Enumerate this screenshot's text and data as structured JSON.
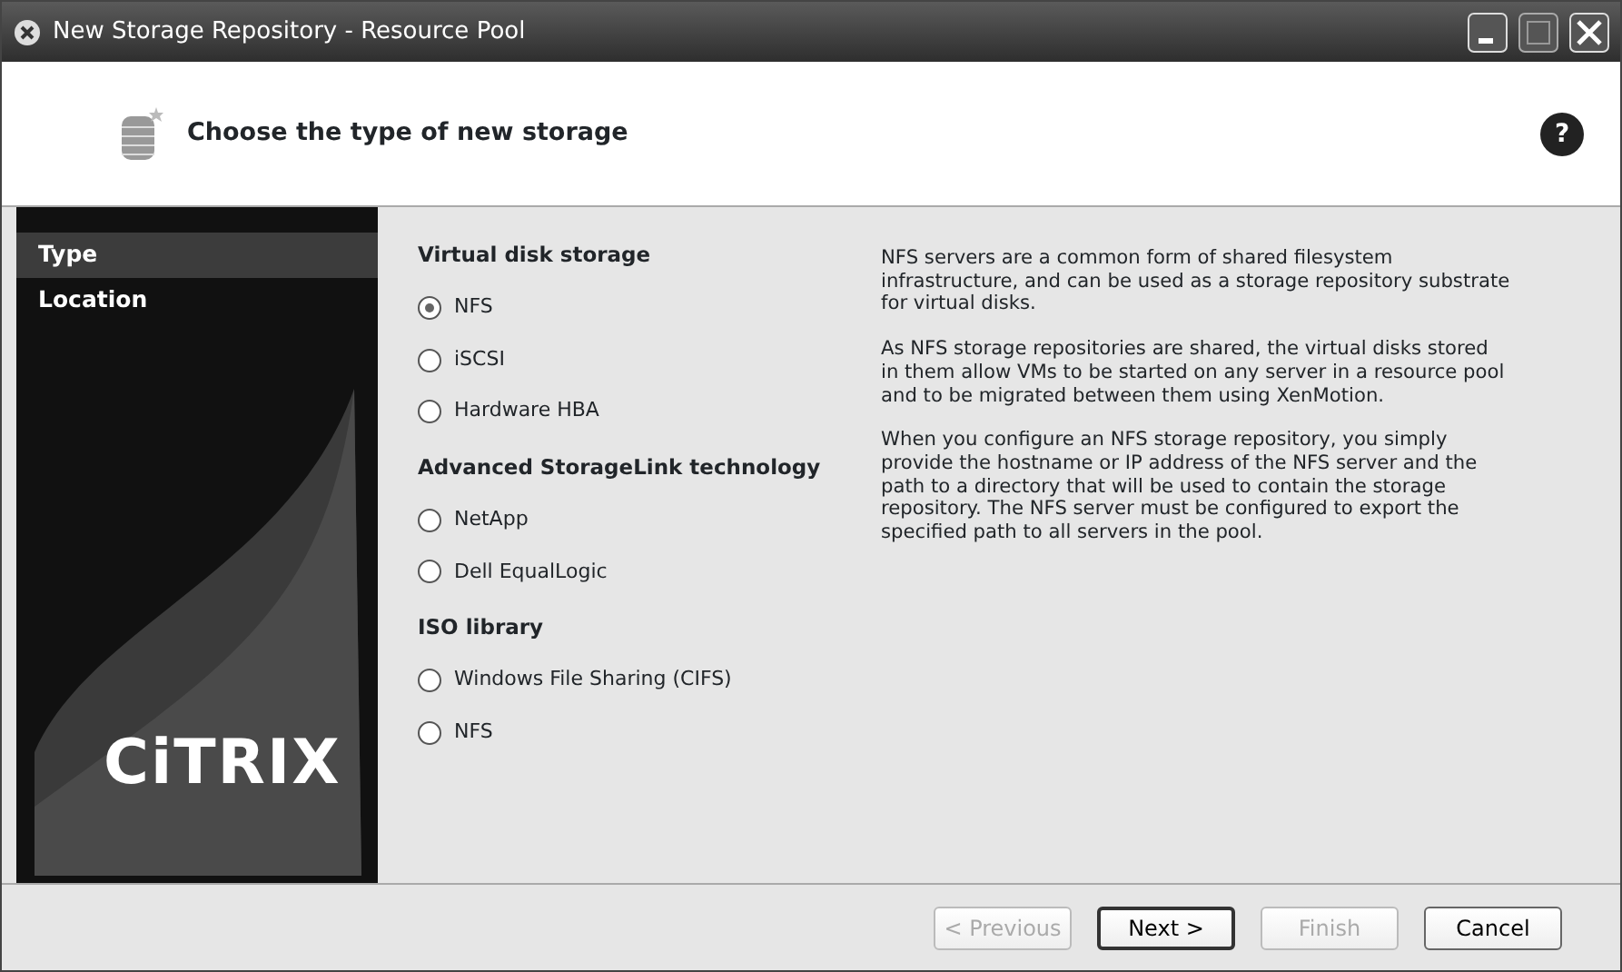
{
  "window": {
    "title": "New Storage Repository - Resource Pool"
  },
  "header": {
    "title": "Choose the type of new storage",
    "help": "?"
  },
  "sidebar": {
    "items": [
      {
        "label": "Type",
        "selected": true
      },
      {
        "label": "Location",
        "selected": false
      }
    ],
    "logo": "CiTRIX"
  },
  "groups": [
    {
      "heading": "Virtual disk storage",
      "options": [
        {
          "label": "NFS",
          "selected": true
        },
        {
          "label": "iSCSI",
          "selected": false
        },
        {
          "label": "Hardware HBA",
          "selected": false
        }
      ]
    },
    {
      "heading": "Advanced StorageLink technology",
      "options": [
        {
          "label": "NetApp",
          "selected": false
        },
        {
          "label": "Dell EqualLogic",
          "selected": false
        }
      ]
    },
    {
      "heading": "ISO library",
      "options": [
        {
          "label": "Windows File Sharing (CIFS)",
          "selected": false
        },
        {
          "label": "NFS",
          "selected": false
        }
      ]
    }
  ],
  "description": [
    "NFS servers are a common form of shared filesystem infrastructure, and can be used as a storage repository substrate for virtual disks.",
    "As NFS storage repositories are shared, the virtual disks stored in them allow VMs to be started on any server in a resource pool and to be migrated between them using XenMotion.",
    "When you configure an NFS storage repository, you simply provide the hostname or IP address of the NFS server and the path to a directory that will be used to contain the storage repository. The NFS server must be configured to export the specified path to all servers in the pool."
  ],
  "buttons": [
    {
      "label": "< Previous",
      "disabled": true,
      "default": false
    },
    {
      "label": "Next >",
      "disabled": false,
      "default": true
    },
    {
      "label": "Finish",
      "disabled": true,
      "default": false
    },
    {
      "label": "Cancel",
      "disabled": false,
      "default": false
    }
  ]
}
